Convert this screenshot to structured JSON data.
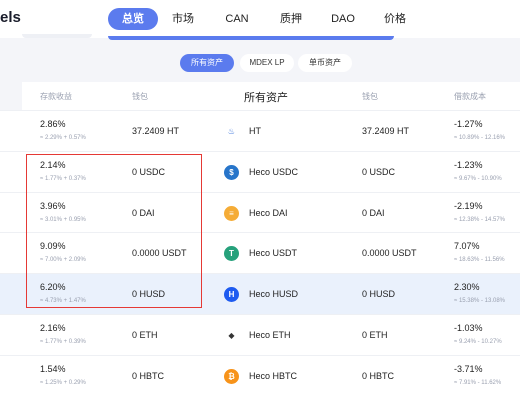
{
  "brand": "els",
  "nav": [
    {
      "label": "总览",
      "active": true
    },
    {
      "label": "市场",
      "active": false
    },
    {
      "label": "CAN",
      "active": false
    },
    {
      "label": "质押",
      "active": false
    },
    {
      "label": "DAO",
      "active": false
    },
    {
      "label": "价格",
      "active": false
    }
  ],
  "filters": [
    {
      "label": "所有资产",
      "active": true
    },
    {
      "label": "MDEX LP",
      "active": false
    },
    {
      "label": "单币资产",
      "active": false
    }
  ],
  "headers": {
    "deposit_apy": "存款收益",
    "wallet_left": "钱包",
    "all_assets": "所有资产",
    "wallet_right": "钱包",
    "borrow_cost": "借款成本"
  },
  "rows": [
    {
      "deposit": "2.86%",
      "deposit_sub": "≈ 2.29% + 0.57%",
      "wallet_left": "37.2409 HT",
      "asset": "HT",
      "wallet_right": "37.2409 HT",
      "borrow": "-1.27%",
      "borrow_sub": "≈ 10.89% - 12.16%",
      "icon": "ht-flame-icon",
      "icon_color": "#ffffff",
      "icon_fg": "#1d5fd6"
    },
    {
      "deposit": "2.14%",
      "deposit_sub": "≈ 1.77% + 0.37%",
      "wallet_left": "0 USDC",
      "asset": "Heco USDC",
      "wallet_right": "0 USDC",
      "borrow": "-1.23%",
      "borrow_sub": "≈ 9.67% - 10.90%",
      "icon": "usdc-icon",
      "icon_color": "#2775ca",
      "icon_fg": "#ffffff"
    },
    {
      "deposit": "3.96%",
      "deposit_sub": "≈ 3.01% + 0.95%",
      "wallet_left": "0 DAI",
      "asset": "Heco DAI",
      "wallet_right": "0 DAI",
      "borrow": "-2.19%",
      "borrow_sub": "≈ 12.38% - 14.57%",
      "icon": "dai-icon",
      "icon_color": "#f5ac37",
      "icon_fg": "#ffffff"
    },
    {
      "deposit": "9.09%",
      "deposit_sub": "≈ 7.00% + 2.09%",
      "wallet_left": "0.0000 USDT",
      "asset": "Heco USDT",
      "wallet_right": "0.0000 USDT",
      "borrow": "7.07%",
      "borrow_sub": "≈ 18.63% - 11.56%",
      "icon": "usdt-icon",
      "icon_color": "#26a17b",
      "icon_fg": "#ffffff"
    },
    {
      "deposit": "6.20%",
      "deposit_sub": "≈ 4.73% + 1.47%",
      "wallet_left": "0 HUSD",
      "asset": "Heco HUSD",
      "wallet_right": "0 HUSD",
      "borrow": "2.30%",
      "borrow_sub": "≈ 15.38% - 13.08%",
      "icon": "husd-icon",
      "icon_color": "#1e5bf0",
      "icon_fg": "#ffffff",
      "highlight": true
    },
    {
      "deposit": "2.16%",
      "deposit_sub": "≈ 1.77% + 0.39%",
      "wallet_left": "0 ETH",
      "asset": "Heco ETH",
      "wallet_right": "0 ETH",
      "borrow": "-1.03%",
      "borrow_sub": "≈ 9.24% - 10.27%",
      "icon": "eth-icon",
      "icon_color": "#ffffff",
      "icon_fg": "#343434"
    },
    {
      "deposit": "1.54%",
      "deposit_sub": "≈ 1.25% + 0.29%",
      "wallet_left": "0 HBTC",
      "asset": "Heco HBTC",
      "wallet_right": "0 HBTC",
      "borrow": "-3.71%",
      "borrow_sub": "≈ 7.91% - 11.62%",
      "icon": "hbtc-icon",
      "icon_color": "#f7931a",
      "icon_fg": "#ffffff"
    }
  ],
  "icon_glyphs": {
    "ht-flame-icon": "♨",
    "usdc-icon": "$",
    "dai-icon": "≡",
    "usdt-icon": "T",
    "husd-icon": "H",
    "eth-icon": "◆",
    "hbtc-icon": "₿"
  }
}
